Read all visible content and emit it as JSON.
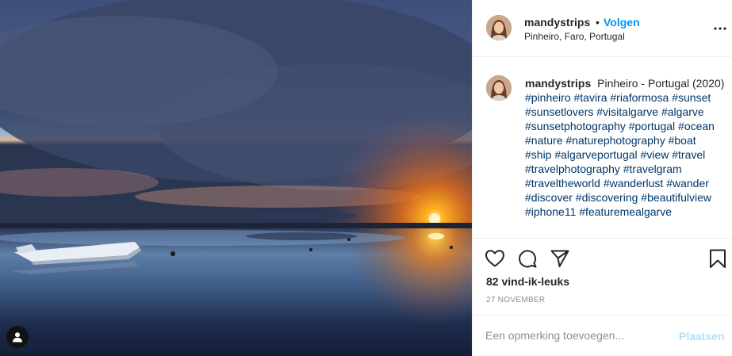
{
  "post": {
    "username": "mandystrips",
    "follow_label": "Volgen",
    "separator": "•",
    "location": "Pinheiro, Faro, Portugal"
  },
  "caption": {
    "username": "mandystrips",
    "text": "Pinheiro - Portugal (2020)",
    "hashtags": "#pinheiro #tavira #riaformosa #sunset #sunsetlovers #visitalgarve #algarve #sunsetphotography #portugal #ocean #nature #naturephotography #boat #ship #algarveportugal #view #travel #travelphotography #travelgram #traveltheworld #wanderlust #wander #discover #discovering #beautifulview #iphone11 #featuremealgarve"
  },
  "stats": {
    "likes": "82 vind-ik-leuks",
    "date": "27 NOVEMBER"
  },
  "comment": {
    "placeholder": "Een opmerking toevoegen...",
    "post_label": "Plaatsen"
  },
  "colors": {
    "link_blue": "#0095f6",
    "hashtag_blue": "#00376b",
    "post_disabled": "#b2dffc"
  }
}
